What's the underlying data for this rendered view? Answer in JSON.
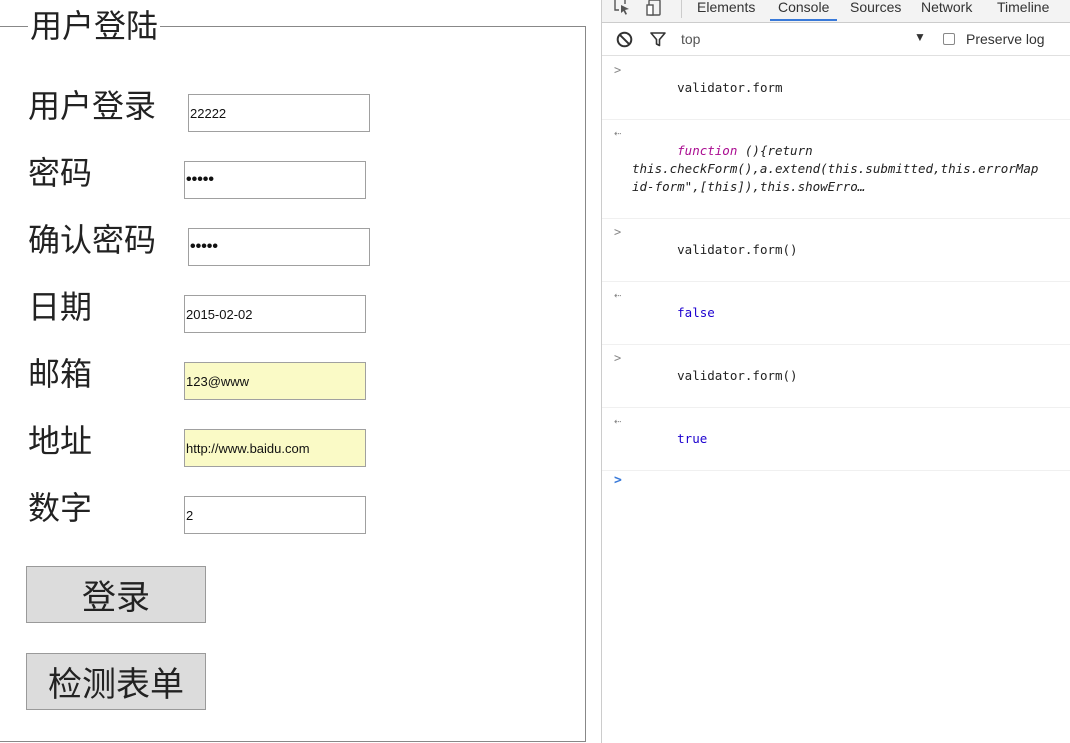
{
  "form": {
    "legend": "用户登陆",
    "rows": [
      {
        "label": "用户登录",
        "value": "22222",
        "type": "text"
      },
      {
        "label": "密码",
        "value": "•••••",
        "type": "password"
      },
      {
        "label": "确认密码",
        "value": "•••••",
        "type": "password"
      },
      {
        "label": "日期",
        "value": "2015-02-02",
        "type": "text"
      },
      {
        "label": "邮箱",
        "value": "123@www",
        "type": "text",
        "highlighted": true
      },
      {
        "label": "地址",
        "value": "http://www.baidu.com",
        "type": "text",
        "highlighted": true
      },
      {
        "label": "数字",
        "value": "2",
        "type": "text"
      }
    ],
    "login_button": "登录",
    "check_button": "检测表单",
    "highlight_color": "#fafac6"
  },
  "devtools": {
    "tabs": [
      "Elements",
      "Console",
      "Sources",
      "Network",
      "Timeline"
    ],
    "active_tab": "Console",
    "context": "top",
    "preserve_log_label": "Preserve log",
    "accent_color": "#3879d9",
    "console": [
      {
        "kind": "input",
        "text": "validator.form"
      },
      {
        "kind": "output",
        "keyword": "function",
        "line1_rest": " (){return",
        "line2": "this.checkForm(),a.extend(this.submitted,this.errorMap",
        "line3": "id-form\",[this]),this.showErro…"
      },
      {
        "kind": "input",
        "text": "validator.form()"
      },
      {
        "kind": "output-bool",
        "text": "false"
      },
      {
        "kind": "input",
        "text": "validator.form()"
      },
      {
        "kind": "output-bool",
        "text": "true"
      }
    ]
  }
}
